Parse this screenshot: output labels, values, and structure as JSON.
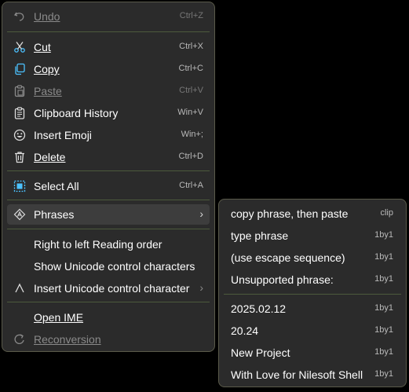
{
  "context_menu": {
    "items": [
      {
        "label": "Undo",
        "shortcut": "Ctrl+Z",
        "icon": "undo-icon",
        "disabled": true
      },
      {
        "label": "Cut",
        "shortcut": "Ctrl+X",
        "icon": "scissors-icon"
      },
      {
        "label": "Copy",
        "shortcut": "Ctrl+C",
        "icon": "copy-icon"
      },
      {
        "label": "Paste",
        "shortcut": "Ctrl+V",
        "icon": "paste-icon",
        "disabled": true
      },
      {
        "label": "Clipboard History",
        "shortcut": "Win+V",
        "icon": "clipboard-icon"
      },
      {
        "label": "Insert Emoji",
        "shortcut": "Win+;",
        "icon": "emoji-icon"
      },
      {
        "label": "Delete",
        "shortcut": "Ctrl+D",
        "icon": "trash-icon"
      },
      {
        "label": "Select All",
        "shortcut": "Ctrl+A",
        "icon": "select-all-icon"
      },
      {
        "label": "Phrases",
        "arrow": "›",
        "icon": "phrases-icon"
      },
      {
        "label": "Right to left Reading order"
      },
      {
        "label": "Show Unicode control characters"
      },
      {
        "label": "Insert Unicode control character",
        "arrow": "›",
        "icon": "caret-icon"
      },
      {
        "label": "Open IME"
      },
      {
        "label": "Reconversion",
        "icon": "reconversion-icon",
        "disabled": true
      }
    ]
  },
  "phrases_submenu": {
    "items": [
      {
        "label": "copy phrase, then paste",
        "tag": "clip"
      },
      {
        "label": "type phrase",
        "tag": "1by1"
      },
      {
        "label": "(use escape sequence)",
        "tag": "1by1"
      },
      {
        "label": "Unsupported phrase:",
        "tag": "1by1"
      },
      {
        "label": "2025.02.12",
        "tag": "1by1"
      },
      {
        "label": "20.24",
        "tag": "1by1"
      },
      {
        "label": "New Project",
        "tag": "1by1"
      },
      {
        "label": "With Love for Nilesoft Shell",
        "tag": "1by1"
      }
    ]
  },
  "colors": {
    "menu_background": "#2b2b2b",
    "separator": "#4c5a3c",
    "hover": "#3d3d3d",
    "accent_icon": "#4cc2ff"
  }
}
